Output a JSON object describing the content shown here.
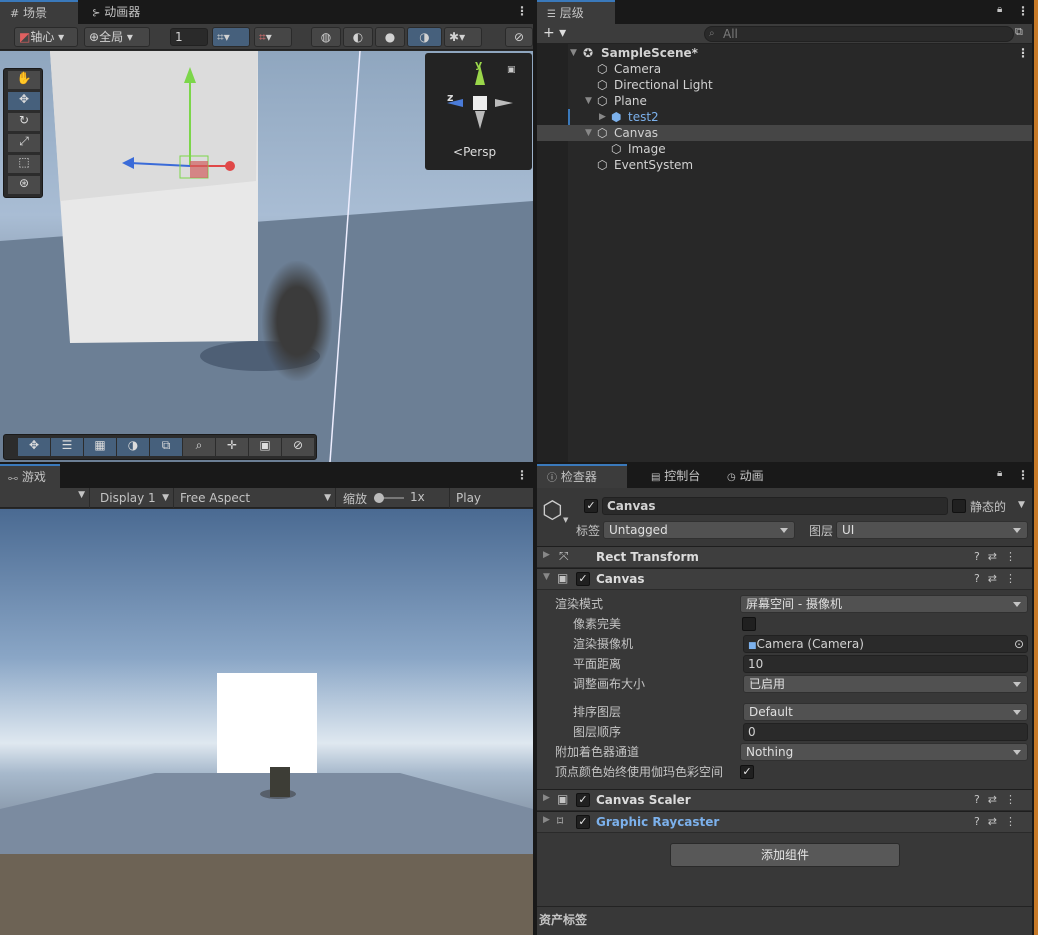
{
  "scene_tabs": [
    {
      "label": "场景",
      "icon": "grid-icon"
    },
    {
      "label": "动画器",
      "icon": "animator-icon"
    }
  ],
  "scene_toolbar": {
    "pivot": "轴心",
    "global": "全局",
    "grid_value": "1"
  },
  "gizmo": {
    "persp_label": "Persp",
    "axis_y": "y",
    "axis_z": "z"
  },
  "hierarchy": {
    "tab": "层级",
    "search_placeholder": "All",
    "items": [
      {
        "label": "SampleScene*",
        "indent": 0,
        "bold": true
      },
      {
        "label": "Camera",
        "indent": 1
      },
      {
        "label": "Directional Light",
        "indent": 1
      },
      {
        "label": "Plane",
        "indent": 1
      },
      {
        "label": "test2",
        "indent": 2,
        "prefab": true
      },
      {
        "label": "Canvas",
        "indent": 1,
        "selected": true
      },
      {
        "label": "Image",
        "indent": 2
      },
      {
        "label": "EventSystem",
        "indent": 1
      }
    ]
  },
  "game": {
    "tab": "游戏",
    "display": "Display 1",
    "aspect": "Free Aspect",
    "scale_label": "缩放",
    "scale_value": "1x",
    "play_focused": "Play Focused"
  },
  "inspector_tabs": [
    {
      "label": "检查器",
      "icon": "info-icon"
    },
    {
      "label": "控制台",
      "icon": "console-icon"
    },
    {
      "label": "动画",
      "icon": "clock-icon"
    }
  ],
  "inspector": {
    "object_name": "Canvas",
    "static_label": "静态的",
    "tag_label": "标签",
    "tag_value": "Untagged",
    "layer_label": "图层",
    "layer_value": "UI",
    "components": {
      "rect_transform": "Rect Transform",
      "canvas": "Canvas",
      "canvas_scaler": "Canvas Scaler",
      "graphic_raycaster": "Graphic Raycaster"
    },
    "props": {
      "render_mode_label": "渲染模式",
      "render_mode_value": "屏幕空间 - 摄像机",
      "pixel_perfect_label": "像素完美",
      "render_camera_label": "渲染摄像机",
      "render_camera_value": "Camera (Camera)",
      "plane_distance_label": "平面距离",
      "plane_distance_value": "10",
      "resize_canvas_label": "调整画布大小",
      "resize_canvas_value": "已启用",
      "sorting_layer_label": "排序图层",
      "sorting_layer_value": "Default",
      "order_label": "图层顺序",
      "order_value": "0",
      "shader_channels_label": "附加着色器通道",
      "shader_channels_value": "Nothing",
      "vertex_color_label": "顶点颜色始终使用伽玛色彩空间"
    },
    "add_component": "添加组件",
    "asset_labels": "资产标签"
  },
  "colors": {
    "accent": "#3a79bb",
    "link": "#7cb1ec",
    "bg": "#383838",
    "panel": "#282828"
  }
}
